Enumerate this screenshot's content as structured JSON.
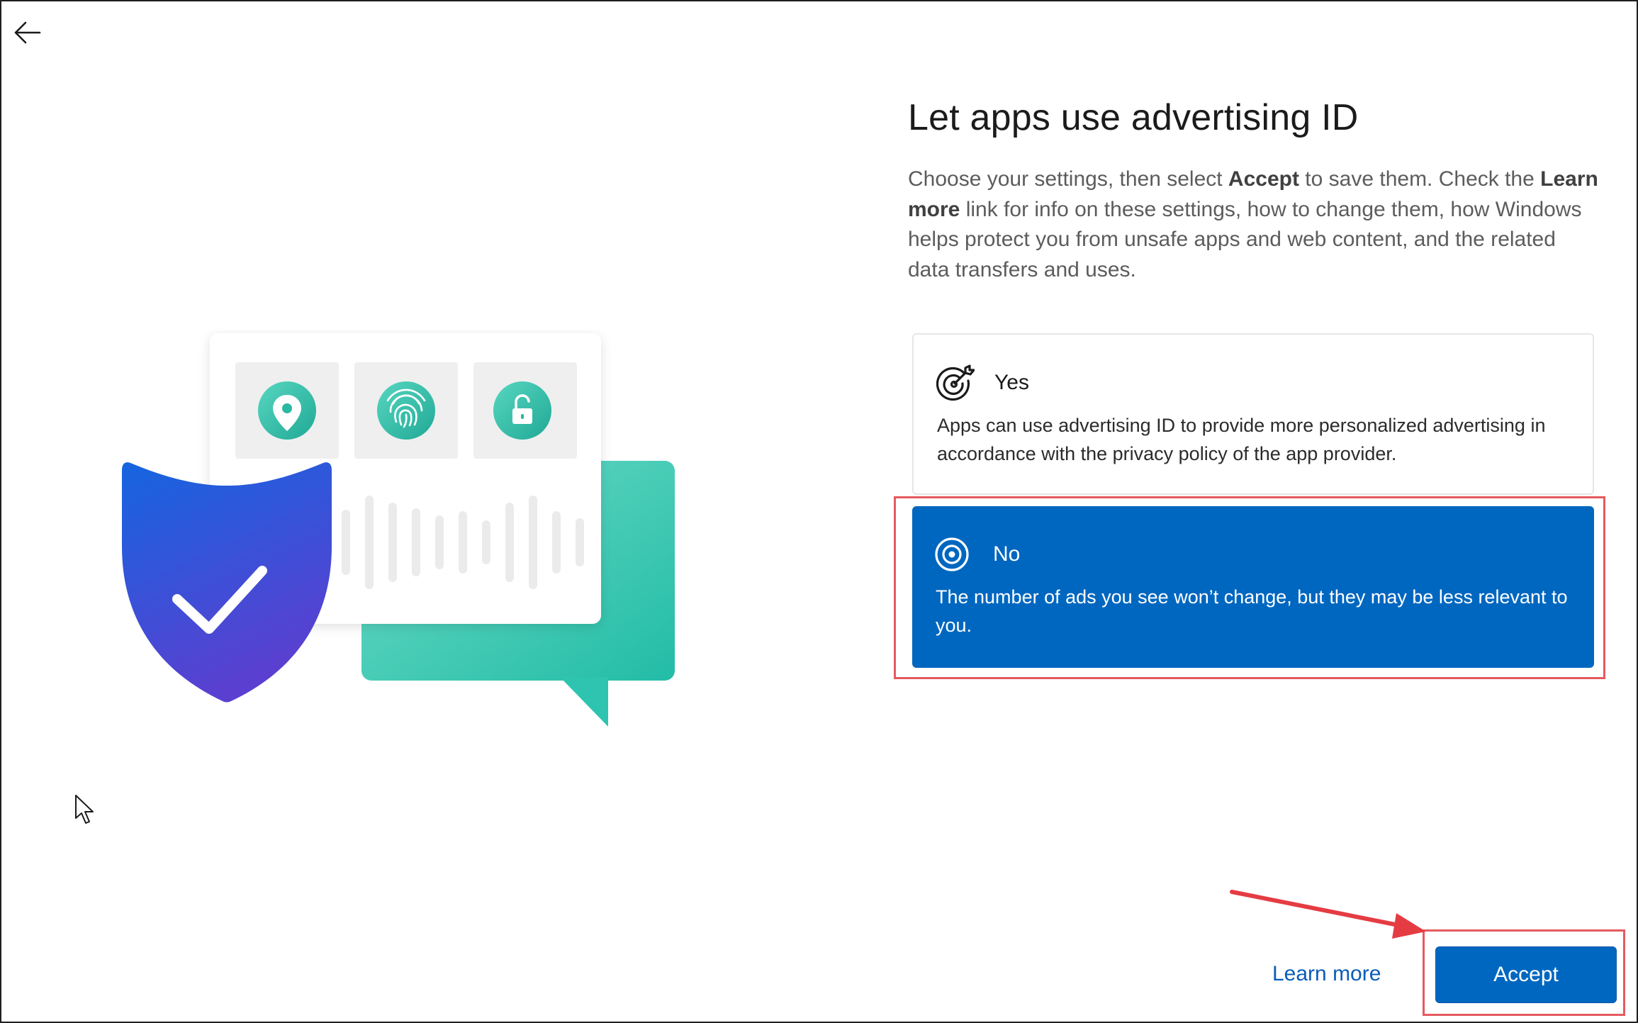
{
  "navigation": {
    "back_icon": "arrow-left-icon"
  },
  "page": {
    "title": "Let apps use advertising ID",
    "intro": {
      "part1": "Choose your settings, then select ",
      "bold1": "Accept",
      "part2": " to save them. Check the ",
      "bold2": "Learn more",
      "part3": " link for info on these settings, how to change them, how Windows helps protect you from unsafe apps and web content, and the related data transfers and uses."
    }
  },
  "options": {
    "yes": {
      "label": "Yes",
      "icon": "target-arrow-icon",
      "description": "Apps can use advertising ID to provide more personalized advertising in accordance with the privacy policy of the app provider."
    },
    "no": {
      "label": "No",
      "icon": "target-icon",
      "description": "The number of ads you see won’t change, but they may be less relevant to you.",
      "selected": true
    }
  },
  "footer": {
    "learn_more": "Learn more",
    "accept": "Accept"
  },
  "colors": {
    "accent": "#0067c0",
    "annotation": "#e55a5f",
    "teal": "#2ec4b0",
    "shield_top": "#1565e0",
    "shield_bottom": "#5b3fd0"
  }
}
